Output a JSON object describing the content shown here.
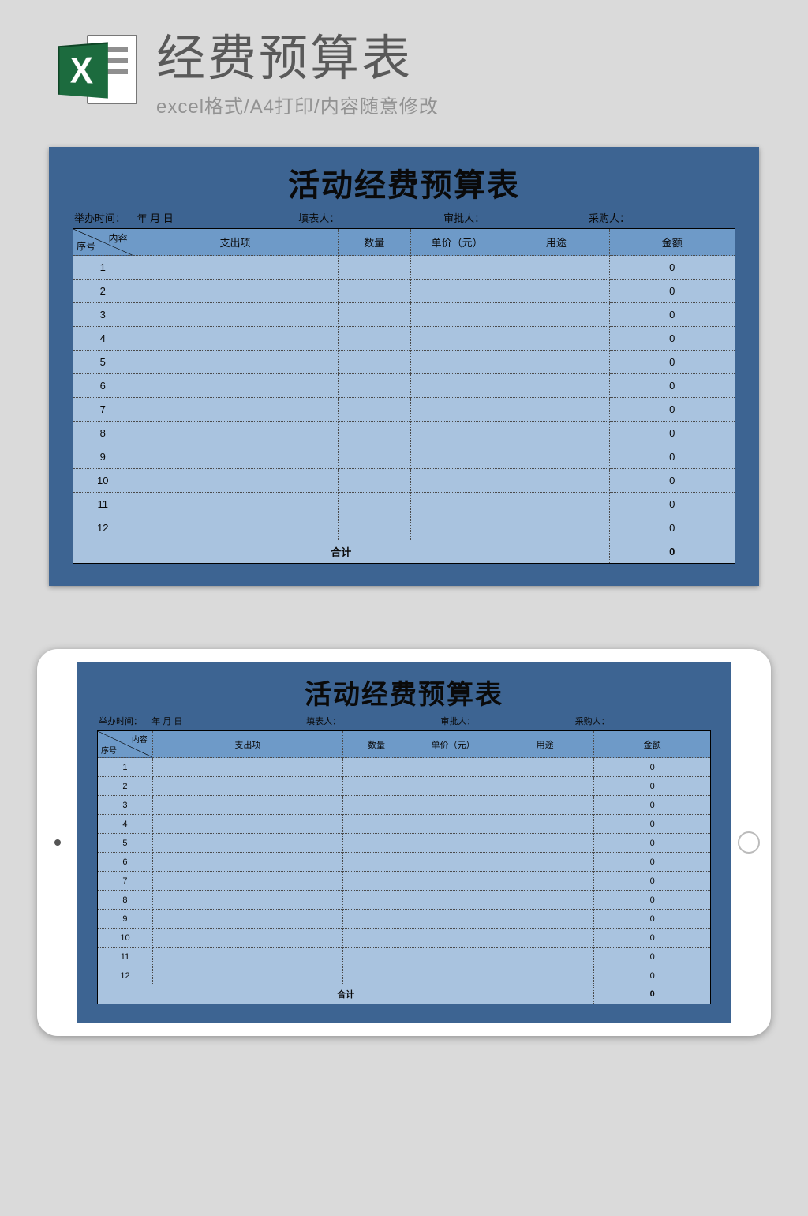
{
  "header": {
    "excel_letter": "X",
    "title": "经费预算表",
    "subtitle": "excel格式/A4打印/内容随意修改"
  },
  "sheet": {
    "title": "活动经费预算表",
    "meta": {
      "time_label": "举办时间：",
      "time_value": "年  月  日",
      "filler_label": "填表人：",
      "approver_label": "审批人：",
      "purchaser_label": "采购人："
    },
    "diag": {
      "top": "内容",
      "bottom": "序号"
    },
    "columns": {
      "item": "支出项",
      "qty": "数量",
      "price": "单价（元）",
      "use": "用途",
      "amount": "金额"
    },
    "rows": [
      {
        "idx": "1",
        "item": "",
        "qty": "",
        "price": "",
        "use": "",
        "amount": "0"
      },
      {
        "idx": "2",
        "item": "",
        "qty": "",
        "price": "",
        "use": "",
        "amount": "0"
      },
      {
        "idx": "3",
        "item": "",
        "qty": "",
        "price": "",
        "use": "",
        "amount": "0"
      },
      {
        "idx": "4",
        "item": "",
        "qty": "",
        "price": "",
        "use": "",
        "amount": "0"
      },
      {
        "idx": "5",
        "item": "",
        "qty": "",
        "price": "",
        "use": "",
        "amount": "0"
      },
      {
        "idx": "6",
        "item": "",
        "qty": "",
        "price": "",
        "use": "",
        "amount": "0"
      },
      {
        "idx": "7",
        "item": "",
        "qty": "",
        "price": "",
        "use": "",
        "amount": "0"
      },
      {
        "idx": "8",
        "item": "",
        "qty": "",
        "price": "",
        "use": "",
        "amount": "0"
      },
      {
        "idx": "9",
        "item": "",
        "qty": "",
        "price": "",
        "use": "",
        "amount": "0"
      },
      {
        "idx": "10",
        "item": "",
        "qty": "",
        "price": "",
        "use": "",
        "amount": "0"
      },
      {
        "idx": "11",
        "item": "",
        "qty": "",
        "price": "",
        "use": "",
        "amount": "0"
      },
      {
        "idx": "12",
        "item": "",
        "qty": "",
        "price": "",
        "use": "",
        "amount": "0"
      }
    ],
    "total": {
      "label": "合计",
      "amount": "0"
    }
  }
}
